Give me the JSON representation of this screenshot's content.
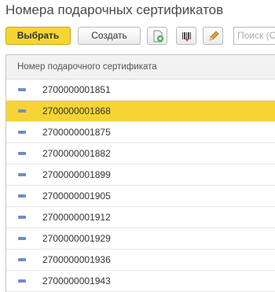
{
  "title": "Номера подарочных сертификатов",
  "toolbar": {
    "choose_label": "Выбрать",
    "create_label": "Создать",
    "search_placeholder": "Поиск (С"
  },
  "table": {
    "column_header": "Номер подарочного сертификата",
    "rows": [
      {
        "number": "2700000001851",
        "selected": false
      },
      {
        "number": "2700000001868",
        "selected": true
      },
      {
        "number": "2700000001875",
        "selected": false
      },
      {
        "number": "2700000001882",
        "selected": false
      },
      {
        "number": "2700000001899",
        "selected": false
      },
      {
        "number": "2700000001905",
        "selected": false
      },
      {
        "number": "2700000001912",
        "selected": false
      },
      {
        "number": "2700000001929",
        "selected": false
      },
      {
        "number": "2700000001936",
        "selected": false
      },
      {
        "number": "2700000001943",
        "selected": false
      }
    ]
  },
  "colors": {
    "accent": "#f6d434",
    "row_marker": "#6d8fc0"
  }
}
